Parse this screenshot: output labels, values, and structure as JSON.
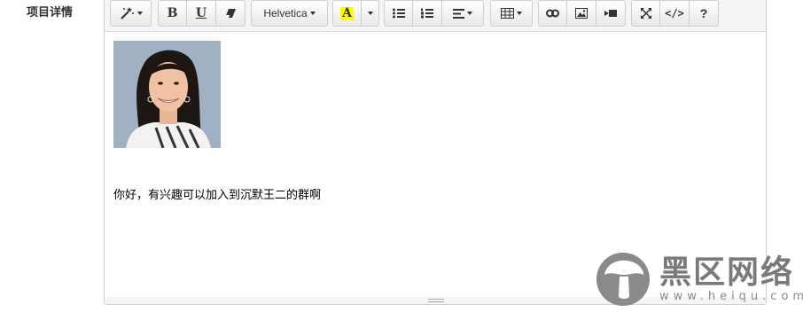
{
  "field": {
    "label": "项目详情"
  },
  "toolbar": {
    "font_name": "Helvetica",
    "bold": "B",
    "underline": "U",
    "font_color_letter": "A",
    "codeview": "</>",
    "help": "?"
  },
  "content": {
    "text": "你好，有兴趣可以加入到沉默王二的群啊"
  },
  "watermark": {
    "title": "黑区网络",
    "url": "www.heiqu.com"
  },
  "colors": {
    "toolbar_bg": "#f5f5f5",
    "highlight": "#ffff00"
  }
}
